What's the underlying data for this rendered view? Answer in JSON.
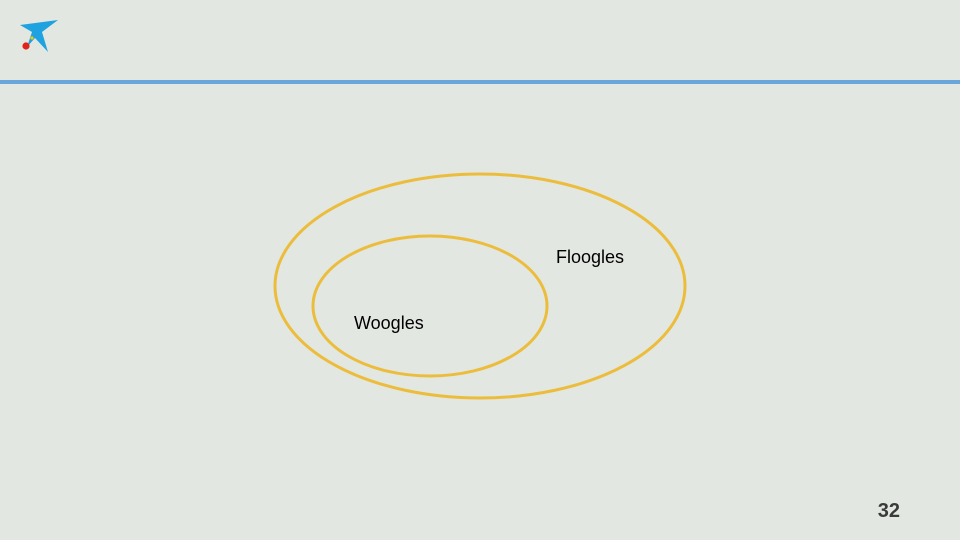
{
  "slide": {
    "page_number": "32",
    "colors": {
      "background": "#e3e7e2",
      "header_rule": "#6aa6dc",
      "set_outline": "#ecbd3c",
      "logo_blue": "#1fa2e0",
      "logo_red": "#e2231a",
      "logo_yellow": "#f7c600"
    },
    "logo": {
      "icon": "star-logo-icon"
    }
  },
  "diagram": {
    "type": "nested-sets",
    "outer_set": {
      "label": "Floogles"
    },
    "inner_set": {
      "label": "Woogles",
      "contained_in": "Floogles"
    }
  }
}
